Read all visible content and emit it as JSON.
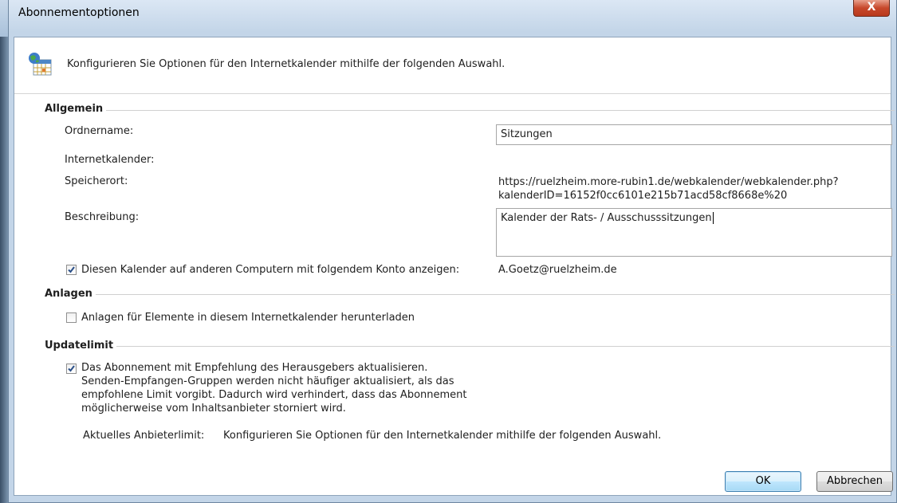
{
  "window": {
    "title": "Abonnementoptionen",
    "close_label": "X"
  },
  "header": {
    "text": "Konfigurieren Sie Optionen für den Internetkalender mithilfe der folgenden Auswahl."
  },
  "general": {
    "section_label": "Allgemein",
    "folder_name_label": "Ordnername:",
    "folder_name_value": "Sitzungen",
    "internet_calendar_label": "Internetkalender:",
    "location_label": "Speicherort:",
    "location_line1": "https://ruelzheim.more-rubin1.de/webkalender/webkalender.php?",
    "location_line2": "kalenderID=16152f0cc6101e215b71acd58cf8668e%20",
    "description_label": "Beschreibung:",
    "description_value": "Kalender der Rats- / Ausschusssitzungen",
    "show_on_other_computers_label": "Diesen Kalender auf anderen Computern mit folgendem Konto anzeigen:",
    "show_on_other_computers_checked": true,
    "account": "A.Goetz@ruelzheim.de"
  },
  "attachments": {
    "section_label": "Anlagen",
    "download_label": "Anlagen für Elemente in diesem Internetkalender herunterladen",
    "download_checked": false
  },
  "update_limit": {
    "section_label": "Updatelimit",
    "publisher_line1": "Das Abonnement mit Empfehlung des Herausgebers aktualisieren.",
    "publisher_line2": "Senden-Empfangen-Gruppen werden nicht häufiger aktualisiert, als das",
    "publisher_line3": "empfohlene Limit vorgibt. Dadurch wird verhindert, dass das Abonnement",
    "publisher_line4": "möglicherweise vom Inhaltsanbieter storniert wird.",
    "publisher_checked": true,
    "current_limit_label": "Aktuelles Anbieterlimit:",
    "current_limit_value": "Konfigurieren Sie Optionen für den Internetkalender mithilfe der folgenden Auswahl."
  },
  "buttons": {
    "ok": "OK",
    "cancel": "Abbrechen"
  }
}
